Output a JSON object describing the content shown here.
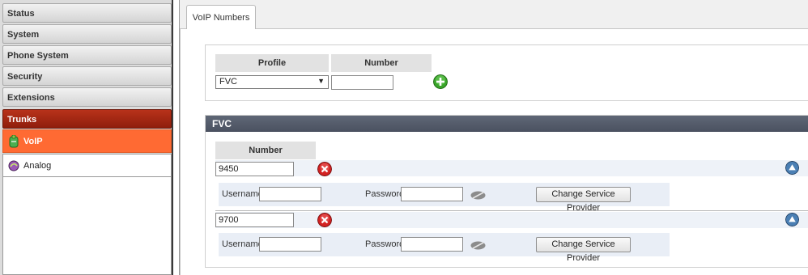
{
  "sidebar": {
    "items": [
      {
        "label": "Status"
      },
      {
        "label": "System"
      },
      {
        "label": "Phone System"
      },
      {
        "label": "Security"
      },
      {
        "label": "Extensions"
      },
      {
        "label": "Trunks"
      }
    ],
    "subitems": [
      {
        "label": "VoIP",
        "icon": "voip-icon"
      },
      {
        "label": "Analog",
        "icon": "analog-icon"
      }
    ]
  },
  "tabs": [
    {
      "label": "VoIP Numbers"
    }
  ],
  "add_form": {
    "profile_header": "Profile",
    "number_header": "Number",
    "profile_value": "FVC",
    "number_value": ""
  },
  "fvc": {
    "title": "FVC",
    "number_header": "Number",
    "entries": [
      {
        "number": "9450",
        "username_label": "Username:",
        "username": "",
        "password_label": "Password:",
        "password": "",
        "button_label": "Change Service Provider"
      },
      {
        "number": "9700",
        "username_label": "Username:",
        "username": "",
        "password_label": "Password:",
        "password": "",
        "button_label": "Change Service Provider"
      }
    ]
  },
  "colors": {
    "active_nav": "#b8321a",
    "active_sub": "#ff6a33",
    "panel_header": "#555c6a",
    "add_button": "#3aa52a",
    "delete_button": "#d32222",
    "collapse_button": "#4a7fb4"
  }
}
